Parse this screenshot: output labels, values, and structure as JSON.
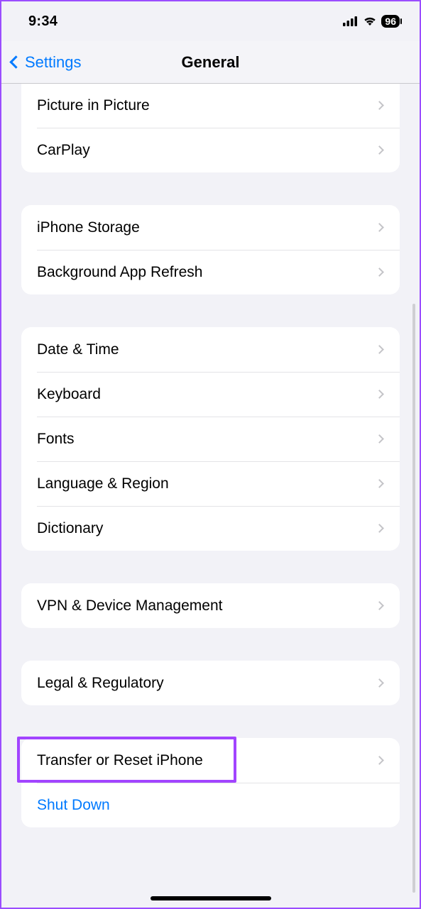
{
  "status": {
    "time": "9:34",
    "battery": "96"
  },
  "nav": {
    "back_label": "Settings",
    "title": "General"
  },
  "groups": [
    {
      "id": "pip",
      "style": "first",
      "rows": [
        {
          "id": "picture-in-picture",
          "label": "Picture in Picture",
          "disclosure": true
        },
        {
          "id": "carplay",
          "label": "CarPlay",
          "disclosure": true
        }
      ]
    },
    {
      "id": "storage",
      "rows": [
        {
          "id": "iphone-storage",
          "label": "iPhone Storage",
          "disclosure": true
        },
        {
          "id": "background-app-refresh",
          "label": "Background App Refresh",
          "disclosure": true
        }
      ]
    },
    {
      "id": "datetime",
      "rows": [
        {
          "id": "date-time",
          "label": "Date & Time",
          "disclosure": true
        },
        {
          "id": "keyboard",
          "label": "Keyboard",
          "disclosure": true
        },
        {
          "id": "fonts",
          "label": "Fonts",
          "disclosure": true
        },
        {
          "id": "language-region",
          "label": "Language & Region",
          "disclosure": true
        },
        {
          "id": "dictionary",
          "label": "Dictionary",
          "disclosure": true
        }
      ]
    },
    {
      "id": "vpn",
      "rows": [
        {
          "id": "vpn-device-management",
          "label": "VPN & Device Management",
          "disclosure": true
        }
      ]
    },
    {
      "id": "legal",
      "rows": [
        {
          "id": "legal-regulatory",
          "label": "Legal & Regulatory",
          "disclosure": true
        }
      ]
    },
    {
      "id": "reset",
      "rows": [
        {
          "id": "transfer-reset",
          "label": "Transfer or Reset iPhone",
          "disclosure": true,
          "highlighted": true
        },
        {
          "id": "shut-down",
          "label": "Shut Down",
          "disclosure": false,
          "accent": true
        }
      ]
    }
  ]
}
